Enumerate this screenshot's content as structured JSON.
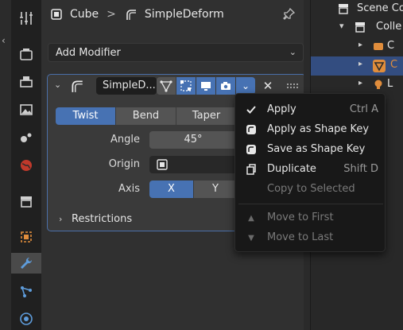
{
  "header": {
    "object_name": "Cube",
    "separator": ">",
    "modifier_name": "SimpleDeform"
  },
  "add_modifier": {
    "label": "Add Modifier"
  },
  "modifier": {
    "name": "SimpleD...",
    "modes": [
      "Twist",
      "Bend",
      "Taper"
    ],
    "selected_mode": "Twist",
    "angle_label": "Angle",
    "angle_value": "45°",
    "origin_label": "Origin",
    "axis_label": "Axis",
    "axis_options": [
      "X",
      "Y"
    ],
    "selected_axis": "X",
    "restrictions_label": "Restrictions"
  },
  "menu": {
    "items": [
      {
        "label": "Apply",
        "shortcut": "Ctrl A",
        "icon": "checkmark-icon",
        "enabled": true
      },
      {
        "label": "Apply as Shape Key",
        "shortcut": "",
        "icon": "shape-key-icon",
        "enabled": true
      },
      {
        "label": "Save as Shape Key",
        "shortcut": "",
        "icon": "shape-key-icon",
        "enabled": true
      },
      {
        "label": "Duplicate",
        "shortcut": "Shift D",
        "icon": "duplicate-icon",
        "enabled": true
      },
      {
        "label": "Copy to Selected",
        "shortcut": "",
        "icon": "",
        "enabled": false
      },
      {
        "label": "Move to First",
        "shortcut": "",
        "icon": "triangle-up-icon",
        "enabled": false
      },
      {
        "label": "Move to Last",
        "shortcut": "",
        "icon": "triangle-down-icon",
        "enabled": false
      }
    ]
  },
  "outliner": {
    "rows": [
      {
        "label": "Scene Co",
        "icon": "scene-collection-icon"
      },
      {
        "label": "Colle",
        "icon": "collection-icon"
      },
      {
        "label": "C",
        "icon": "camera-icon"
      },
      {
        "label": "C",
        "icon": "mesh-object-icon"
      },
      {
        "label": "L",
        "icon": "light-icon"
      }
    ]
  },
  "colors": {
    "accent": "#4772b3",
    "panel_bg": "#303030",
    "menu_bg": "#181818",
    "modifier_border": "#4a6fa8",
    "wrench_active": "#5e9cdb"
  }
}
